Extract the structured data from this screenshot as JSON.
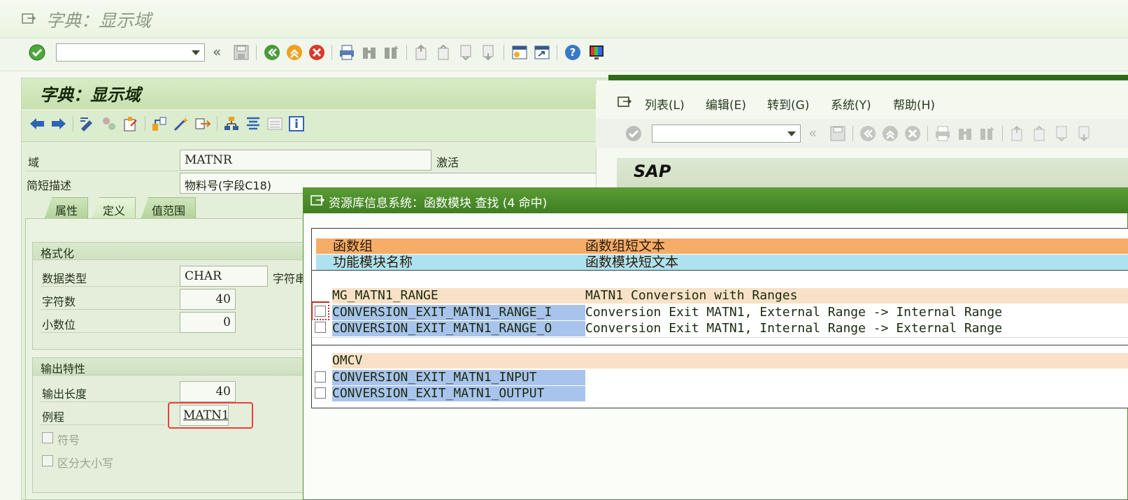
{
  "app": {
    "title": "字典：显示域"
  },
  "panel": {
    "title": "字典：显示域",
    "domain_label": "域",
    "domain_value": "MATNR",
    "domain_status": "激活",
    "short_desc_label": "简短描述",
    "short_desc_value": "物料号(字段C18)",
    "tabs": [
      {
        "label": "属性",
        "active": false
      },
      {
        "label": "定义",
        "active": true
      },
      {
        "label": "值范围",
        "active": false
      }
    ]
  },
  "format_group": {
    "title": "格式化",
    "data_type_label": "数据类型",
    "data_type_value": "CHAR",
    "data_type_desc": "字符串",
    "chars_label": "字符数",
    "chars_value": "40",
    "decimals_label": "小数位",
    "decimals_value": "0"
  },
  "output_group": {
    "title": "输出特性",
    "output_length_label": "输出长度",
    "output_length_value": "40",
    "routine_label": "例程",
    "routine_value": "MATN1",
    "sign_label": "符号",
    "case_label": "区分大小写"
  },
  "sap_window": {
    "menus": [
      {
        "label": "列表(L)"
      },
      {
        "label": "编辑(E)"
      },
      {
        "label": "转到(G)"
      },
      {
        "label": "系统(Y)"
      },
      {
        "label": "帮助(H)"
      }
    ],
    "title": "SAP"
  },
  "dialog": {
    "title": "资源库信息系统：函数模块 查找 (4 命中)",
    "header": {
      "group_col": "函数组",
      "group_text_col": "函数组短文本",
      "module_col": "功能模块名称",
      "module_text_col": "函数模块短文本"
    },
    "groups": [
      {
        "name": "MG_MATN1_RANGE",
        "text": "MATN1 Conversion with Ranges",
        "modules": [
          {
            "name": "CONVERSION_EXIT_MATN1_RANGE_I",
            "text": "Conversion Exit MATN1, External Range -> Internal Range"
          },
          {
            "name": "CONVERSION_EXIT_MATN1_RANGE_O",
            "text": "Conversion Exit MATN1, Internal Range -> External Range"
          }
        ]
      },
      {
        "name": "OMCV",
        "text": "",
        "modules": [
          {
            "name": "CONVERSION_EXIT_MATN1_INPUT",
            "text": ""
          },
          {
            "name": "CONVERSION_EXIT_MATN1_OUTPUT",
            "text": ""
          }
        ]
      }
    ]
  },
  "colors": {
    "header_orange": "#f5ad68",
    "header_cyan": "#aee2f0",
    "group_beige": "#f8e1c7",
    "module_blue": "#a9c4ec",
    "dialog_green": "#4a8c2a",
    "highlight_red": "#e8413a"
  }
}
